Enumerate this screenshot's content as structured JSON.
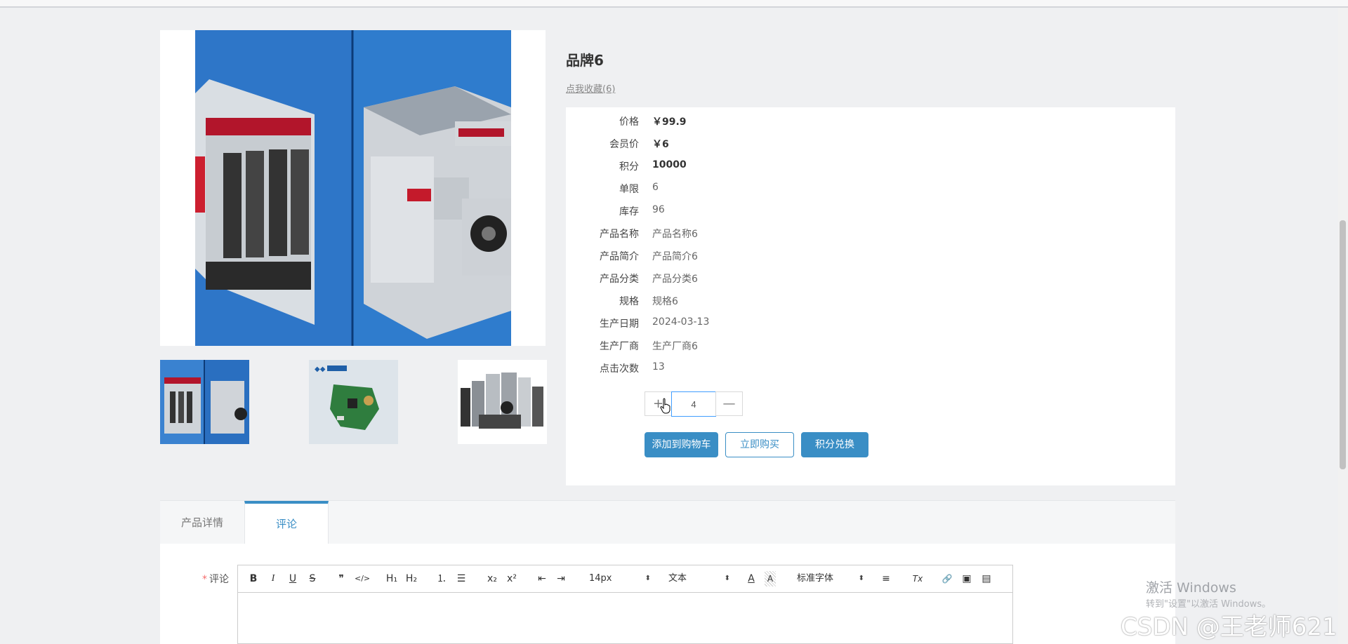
{
  "product": {
    "title": "品牌6",
    "favorite_link": "点我收藏(6)"
  },
  "details": [
    {
      "label": "价格",
      "value": "￥99.9"
    },
    {
      "label": "会员价",
      "value": "￥6"
    },
    {
      "label": "积分",
      "value": "10000"
    },
    {
      "label": "单限",
      "value": "6"
    },
    {
      "label": "库存",
      "value": "96"
    },
    {
      "label": "产品名称",
      "value": "产品名称6"
    },
    {
      "label": "产品简介",
      "value": "产品简介6"
    },
    {
      "label": "产品分类",
      "value": "产品分类6"
    },
    {
      "label": "规格",
      "value": "规格6"
    },
    {
      "label": "生产日期",
      "value": "2024-03-13"
    },
    {
      "label": "生产厂商",
      "value": "生产厂商6"
    },
    {
      "label": "点击次数",
      "value": "13"
    }
  ],
  "quantity": {
    "plus": "+",
    "minus": "—",
    "value": "4"
  },
  "actions": {
    "add_to_cart": "添加到购物车",
    "buy_now": "立即购买",
    "points_redeem": "积分兑换"
  },
  "tabs": {
    "detail": "产品详情",
    "comment": "评论"
  },
  "comment_form": {
    "required_mark": "*",
    "label": "评论"
  },
  "editor_toolbar": {
    "bold": "B",
    "italic": "I",
    "underline": "U",
    "strike": "S",
    "quote": "❞",
    "code": "</>",
    "h1": "H₁",
    "h2": "H₂",
    "ordered_list": "⒈",
    "bullet_list": "☰",
    "subscript": "x₂",
    "superscript": "x²",
    "outdent": "⇤",
    "indent": "⇥",
    "size": "14px",
    "style": "文本",
    "font_color": "A",
    "bg_color": "A",
    "font_family": "标准字体",
    "align": "≡",
    "clean": "Tx",
    "link": "🔗",
    "image": "▣",
    "video": "▤"
  },
  "watermarks": {
    "activate_title": "激活 Windows",
    "activate_sub": "转到\"设置\"以激活 Windows。",
    "csdn": "CSDN @王老师621"
  },
  "colors": {
    "accent": "#3a8ec5",
    "page_bg": "#eff0f2",
    "required": "#f56c6c"
  }
}
